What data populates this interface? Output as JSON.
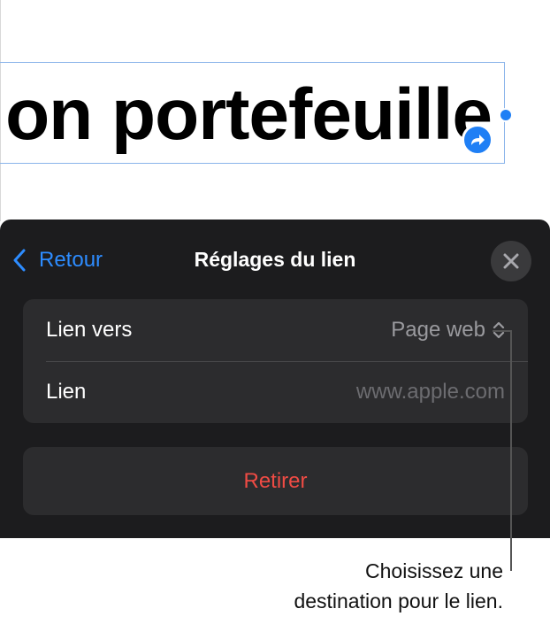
{
  "canvas": {
    "text_box_text": "on portefeuille"
  },
  "panel": {
    "back_label": "Retour",
    "title": "Réglages du lien",
    "rows": [
      {
        "label": "Lien vers",
        "value": "Page web"
      },
      {
        "label": "Lien",
        "placeholder": "www.apple.com"
      }
    ],
    "remove_label": "Retirer"
  },
  "callout": {
    "line1": "Choisissez une",
    "line2": "destination pour le lien."
  },
  "colors": {
    "accent": "#2d8cff",
    "panel_bg": "#1c1c1e",
    "group_bg": "#2c2c2e",
    "destructive": "#ef4b44"
  },
  "icons": {
    "back": "chevron-left-icon",
    "close": "xmark-icon",
    "popup": "chevron-up-down-icon",
    "link_badge": "arrow-turn-right-icon"
  }
}
